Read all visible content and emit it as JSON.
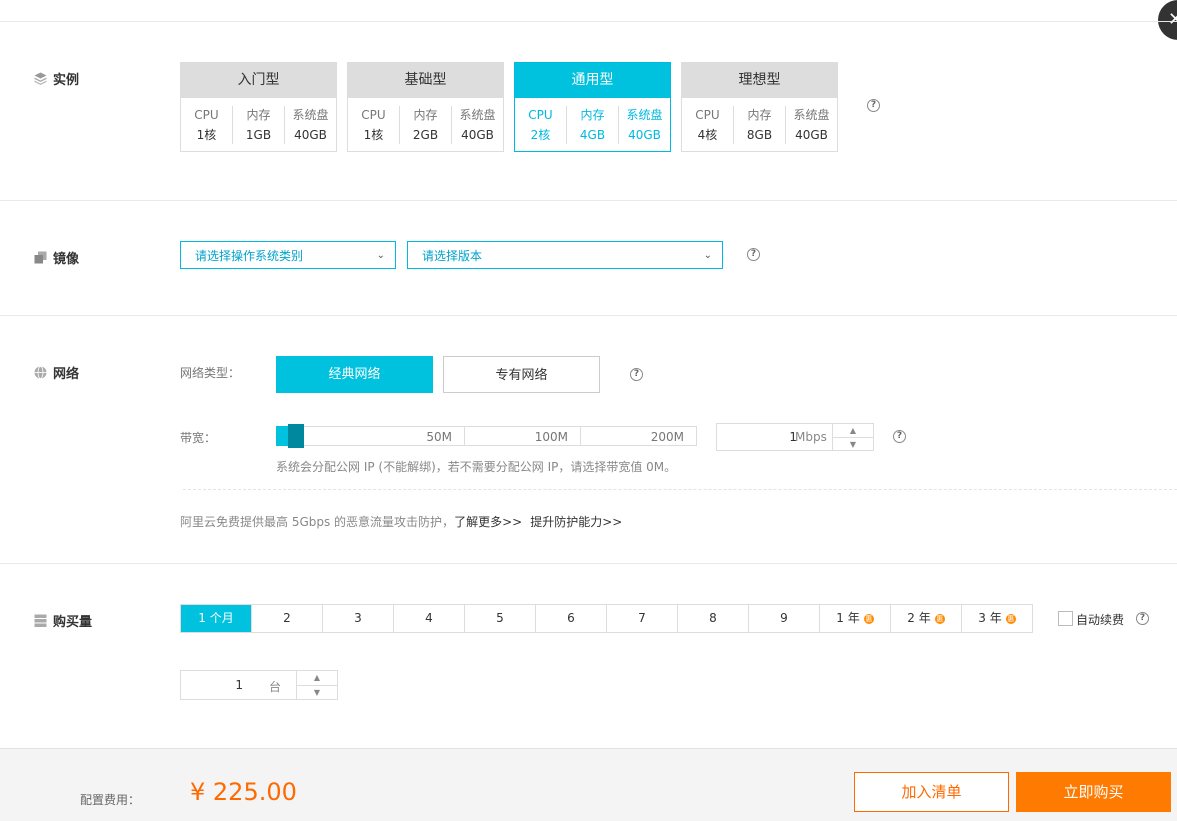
{
  "instance": {
    "label": "实例",
    "cards": [
      {
        "name": "入门型",
        "cpu_label": "CPU",
        "mem_label": "内存",
        "disk_label": "系统盘",
        "cpu": "1核",
        "mem": "1GB",
        "disk": "40GB"
      },
      {
        "name": "基础型",
        "cpu_label": "CPU",
        "mem_label": "内存",
        "disk_label": "系统盘",
        "cpu": "1核",
        "mem": "2GB",
        "disk": "40GB"
      },
      {
        "name": "通用型",
        "cpu_label": "CPU",
        "mem_label": "内存",
        "disk_label": "系统盘",
        "cpu": "2核",
        "mem": "4GB",
        "disk": "40GB"
      },
      {
        "name": "理想型",
        "cpu_label": "CPU",
        "mem_label": "内存",
        "disk_label": "系统盘",
        "cpu": "4核",
        "mem": "8GB",
        "disk": "40GB"
      }
    ],
    "selected_index": 2
  },
  "image": {
    "label": "镜像",
    "os_placeholder": "请选择操作系统类别",
    "version_placeholder": "请选择版本"
  },
  "network": {
    "label": "网络",
    "type_label": "网络类型：",
    "classic": "经典网络",
    "vpc": "专有网络",
    "bandwidth_label": "带宽：",
    "ticks": [
      "50M",
      "100M",
      "200M"
    ],
    "bandwidth_value": "1",
    "bandwidth_unit": "Mbps",
    "ip_note": "系统会分配公网 IP (不能解绑)，若不需要分配公网 IP，请选择带宽值 0M。",
    "ddos_note": "阿里云免费提供最高 5Gbps 的恶意流量攻击防护，",
    "learn_more": "了解更多>>",
    "upgrade": "提升防护能力>>"
  },
  "purchase": {
    "label": "购买量",
    "durations": [
      "1 个月",
      "2",
      "3",
      "4",
      "5",
      "6",
      "7",
      "8",
      "9",
      "1 年",
      "2 年",
      "3 年"
    ],
    "discount_mark": "惠",
    "auto_renew": "自动续费",
    "quantity": "1",
    "quantity_unit": "台"
  },
  "footer": {
    "cost_label": "配置费用：",
    "price": "¥ 225.00",
    "add_to_list": "加入清单",
    "buy_now": "立即购买"
  },
  "close_glyph": "✕",
  "help_glyph": "?",
  "colors": {
    "accent": "#00c1de",
    "orange": "#ff6a00"
  }
}
